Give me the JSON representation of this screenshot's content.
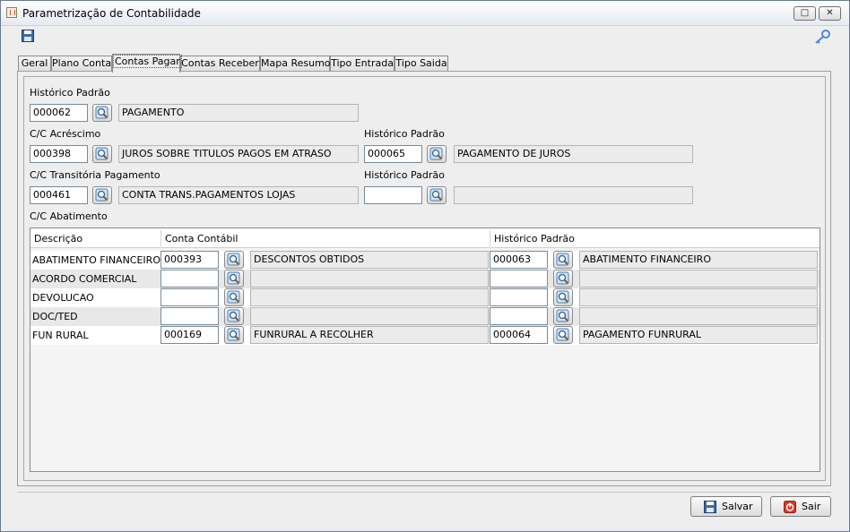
{
  "window": {
    "title": "Parametrização de Contabilidade"
  },
  "tabs": [
    {
      "label": "Geral",
      "active": false
    },
    {
      "label": "Plano Conta",
      "active": false
    },
    {
      "label": "Contas Pagar",
      "active": true
    },
    {
      "label": "Contas Receber",
      "active": false
    },
    {
      "label": "Mapa Resumo",
      "active": false
    },
    {
      "label": "Tipo Entrada",
      "active": false
    },
    {
      "label": "Tipo Saida",
      "active": false
    }
  ],
  "form": {
    "historico_padrao": {
      "label": "Histórico Padrão",
      "code": "000062",
      "description": "PAGAMENTO"
    },
    "cc_acrescimo": {
      "label": "C/C Acréscimo",
      "code": "000398",
      "description": "JUROS SOBRE TITULOS PAGOS EM ATRASO",
      "hist_label": "Histórico Padrão",
      "hist_code": "000065",
      "hist_description": "PAGAMENTO DE JUROS"
    },
    "cc_transitoria": {
      "label": "C/C Transitória Pagamento",
      "code": "000461",
      "description": "CONTA TRANS.PAGAMENTOS LOJAS",
      "hist_label": "Histórico Padrão",
      "hist_code": "",
      "hist_description": ""
    },
    "cc_abatimento": {
      "label": "C/C Abatimento"
    }
  },
  "grid": {
    "headers": {
      "descricao": "Descrição",
      "conta": "Conta Contábil",
      "historico": "Histórico Padrão"
    },
    "rows": [
      {
        "descricao": "ABATIMENTO FINANCEIRO",
        "conta_code": "000393",
        "conta_desc": "DESCONTOS OBTIDOS",
        "hist_code": "000063",
        "hist_desc": "ABATIMENTO FINANCEIRO"
      },
      {
        "descricao": "ACORDO COMERCIAL",
        "conta_code": "",
        "conta_desc": "",
        "hist_code": "",
        "hist_desc": ""
      },
      {
        "descricao": "DEVOLUCAO",
        "conta_code": "",
        "conta_desc": "",
        "hist_code": "",
        "hist_desc": ""
      },
      {
        "descricao": "DOC/TED",
        "conta_code": "",
        "conta_desc": "",
        "hist_code": "",
        "hist_desc": ""
      },
      {
        "descricao": "FUN RURAL",
        "conta_code": "000169",
        "conta_desc": "FUNRURAL A RECOLHER",
        "hist_code": "000064",
        "hist_desc": "PAGAMENTO FUNRURAL"
      }
    ]
  },
  "buttons": {
    "save": "Salvar",
    "exit": "Sair"
  },
  "icons": {
    "app": "java-app-icon",
    "save_toolbar": "floppy-disk-icon",
    "key": "key-icon",
    "lookup": "magnifier-lookup-icon",
    "restore": "restore-window-icon",
    "close": "close-window-icon",
    "save_button": "floppy-disk-icon",
    "exit_button": "power-exit-icon"
  },
  "colors": {
    "exit_icon": "#d93a2b",
    "save_icon": "#3b6ea8",
    "key_icon": "#4a8ad4"
  }
}
